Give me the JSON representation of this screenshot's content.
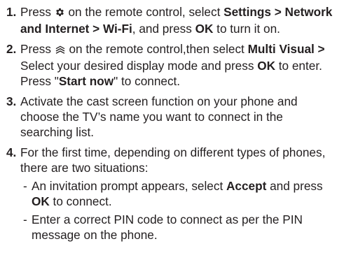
{
  "steps": [
    {
      "number": "1.",
      "parts": {
        "t1": "Press ",
        "icon": "settings-gear-icon",
        "t2": " on the remote control, select ",
        "b1": "Settings > Network and Internet > Wi-Fi",
        "t3": ", and press ",
        "b2": "OK",
        "t4": " to turn it on."
      }
    },
    {
      "number": "2.",
      "parts": {
        "t1": "Press ",
        "icon": "source-input-icon",
        "t2": " on the remote control,then select ",
        "b1": "Multi Visual >",
        "t3": " Select your desired display mode and press ",
        "b2": "OK",
        "t4": " to enter. Press \"",
        "b3": "Start now",
        "t5": "\" to connect."
      }
    },
    {
      "number": "3.",
      "parts": {
        "t1": "Activate the cast screen function on your phone and choose the TV’s name you want to connect in the searching list."
      }
    },
    {
      "number": "4.",
      "parts": {
        "t1": "For the first time, depending on different types of phones, there are two situations:"
      },
      "subitems": [
        {
          "dash": "-",
          "t1": "An invitation prompt appears, select ",
          "b1": "Accept",
          "t2": " and press ",
          "b2": "OK",
          "t3": " to connect."
        },
        {
          "dash": "-",
          "t1": "Enter a correct PIN code to connect as per the PIN message on the phone."
        }
      ]
    }
  ]
}
